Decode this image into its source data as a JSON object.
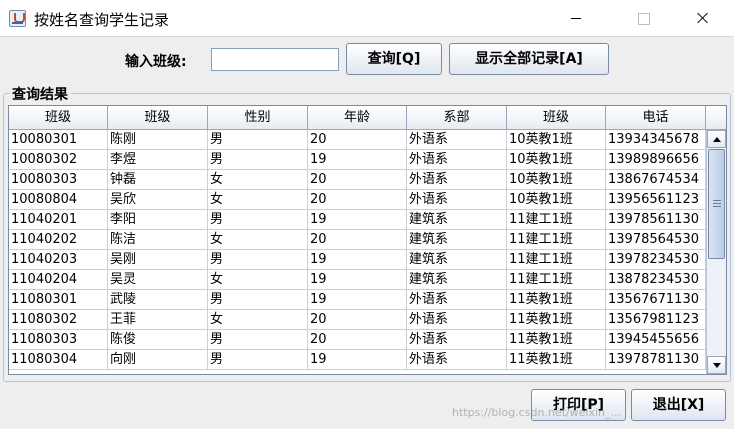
{
  "window": {
    "title": "按姓名查询学生记录",
    "icon": "java-cup-icon"
  },
  "search": {
    "label": "输入班级:",
    "value": ""
  },
  "buttons": {
    "query": "查询[Q]",
    "show_all": "显示全部记录[A]",
    "print": "打印[P]",
    "exit": "退出[X]"
  },
  "results": {
    "title": "查询结果",
    "columns": [
      "班级",
      "班级",
      "性别",
      "年龄",
      "系部",
      "班级",
      "电话"
    ],
    "rows": [
      [
        "10080301",
        "陈刚",
        "男",
        "20",
        "外语系",
        "10英教1班",
        "13934345678"
      ],
      [
        "10080302",
        "李煜",
        "男",
        "19",
        "外语系",
        "10英教1班",
        "13989896656"
      ],
      [
        "10080303",
        "钟磊",
        "女",
        "20",
        "外语系",
        "10英教1班",
        "13867674534"
      ],
      [
        "10080804",
        "吴欣",
        "女",
        "20",
        "外语系",
        "10英教1班",
        "13956561123"
      ],
      [
        "11040201",
        "李阳",
        "男",
        "19",
        "建筑系",
        "11建工1班",
        "13978561130"
      ],
      [
        "11040202",
        "陈洁",
        "女",
        "20",
        "建筑系",
        "11建工1班",
        "13978564530"
      ],
      [
        "11040203",
        "吴刚",
        "男",
        "19",
        "建筑系",
        "11建工1班",
        "13978234530"
      ],
      [
        "11040204",
        "吴灵",
        "女",
        "19",
        "建筑系",
        "11建工1班",
        "13878234530"
      ],
      [
        "11080301",
        "武陵",
        "男",
        "19",
        "外语系",
        "11英教1班",
        "13567671130"
      ],
      [
        "11080302",
        "王菲",
        "女",
        "20",
        "外语系",
        "11英教1班",
        "13567981123"
      ],
      [
        "11080303",
        "陈俊",
        "男",
        "20",
        "外语系",
        "11英教1班",
        "13945455656"
      ],
      [
        "11080304",
        "向刚",
        "男",
        "19",
        "外语系",
        "11英教1班",
        "13978781130"
      ]
    ]
  },
  "watermark": "https://blog.csdn.net/weixin_..."
}
